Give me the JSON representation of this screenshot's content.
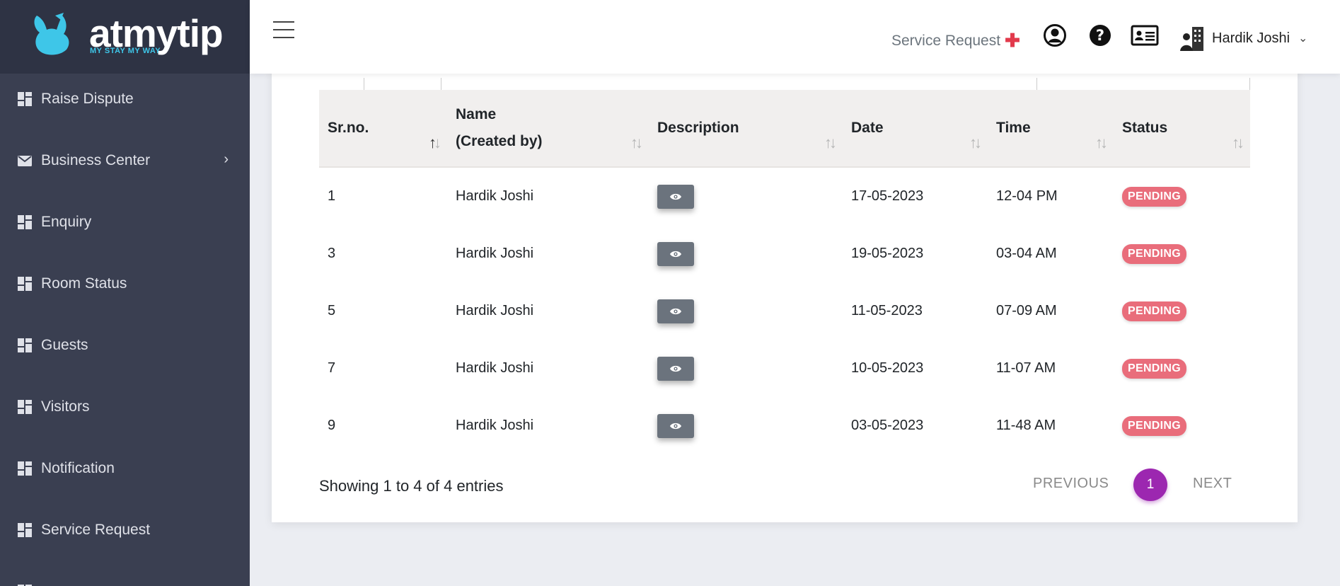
{
  "brand": {
    "name": "atmytip",
    "tagline": "MY STAY MY WAY",
    "accent": "#3ec6e8"
  },
  "sidebar": {
    "items": [
      {
        "label": "Raise Dispute",
        "icon": "dashboard-icon"
      },
      {
        "label": "Business Center",
        "icon": "envelope-icon",
        "has_submenu": true
      },
      {
        "label": "Enquiry",
        "icon": "dashboard-icon"
      },
      {
        "label": "Room Status",
        "icon": "dashboard-icon"
      },
      {
        "label": "Guests",
        "icon": "dashboard-icon"
      },
      {
        "label": "Visitors",
        "icon": "dashboard-icon"
      },
      {
        "label": "Notification",
        "icon": "dashboard-icon"
      },
      {
        "label": "Service Request",
        "icon": "dashboard-icon"
      }
    ]
  },
  "header": {
    "service_request_label": "Service Request",
    "user_name": "Hardik Joshi",
    "icons": [
      "user-circle-icon",
      "question-circle-icon",
      "id-card-icon"
    ]
  },
  "table": {
    "columns": [
      "Sr.no.",
      "Name",
      "(Created by)",
      "Description",
      "Date",
      "Time",
      "Status"
    ],
    "rows": [
      {
        "srno": "1",
        "name": "Hardik Joshi",
        "date": "17-05-2023",
        "time": "12-04 PM",
        "status": "PENDING"
      },
      {
        "srno": "3",
        "name": "Hardik Joshi",
        "date": "19-05-2023",
        "time": "03-04 AM",
        "status": "PENDING"
      },
      {
        "srno": "5",
        "name": "Hardik Joshi",
        "date": "11-05-2023",
        "time": "07-09 AM",
        "status": "PENDING"
      },
      {
        "srno": "7",
        "name": "Hardik Joshi",
        "date": "10-05-2023",
        "time": "11-07 AM",
        "status": "PENDING"
      },
      {
        "srno": "9",
        "name": "Hardik Joshi",
        "date": "03-05-2023",
        "time": "11-48 AM",
        "status": "PENDING"
      }
    ]
  },
  "footer": {
    "info": "Showing 1 to 4 of 4 entries",
    "previous": "PREVIOUS",
    "page": "1",
    "next": "NEXT"
  },
  "colors": {
    "sidebar": "#3a3f51",
    "badge": "#e96d7b",
    "page_active": "#9c27b0",
    "service_plus": "#e23a4c"
  }
}
